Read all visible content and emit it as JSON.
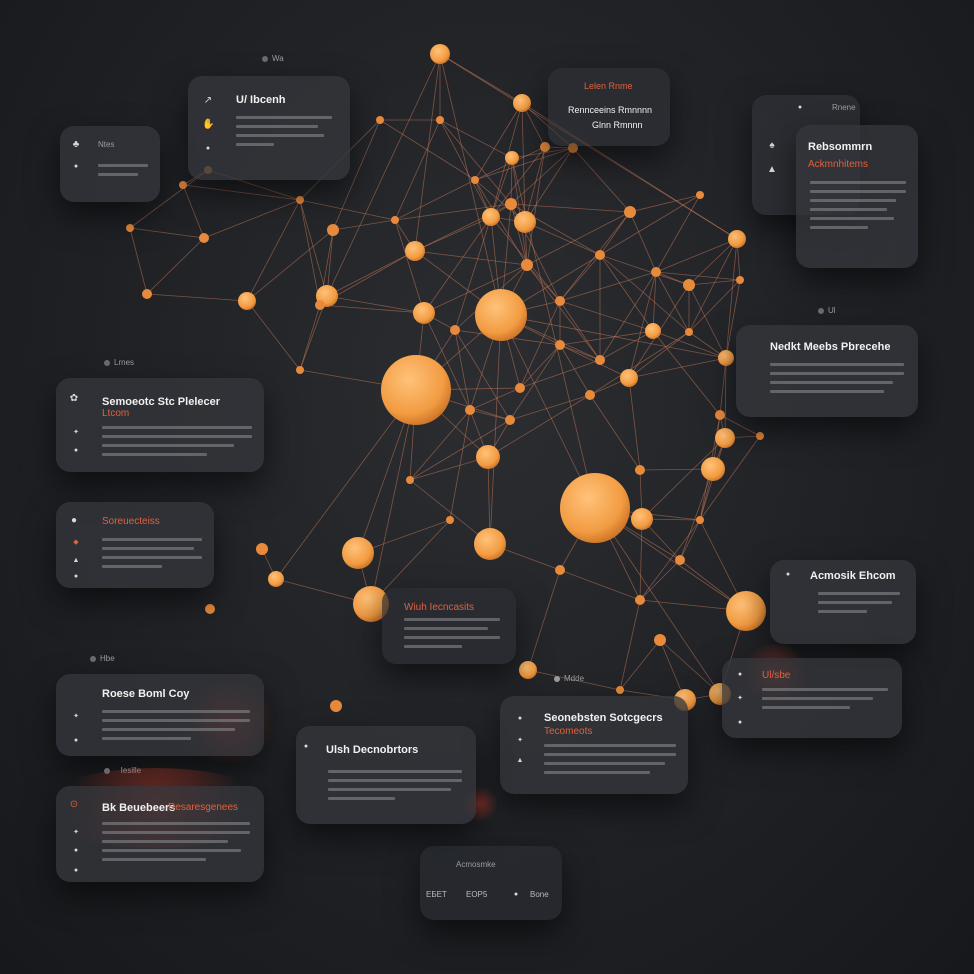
{
  "colors": {
    "background": "#1e2024",
    "node": "#f2a248",
    "link": "#c66a4a",
    "card": "#34363b",
    "accent_red": "#e0613a"
  },
  "cards": {
    "top_left": {
      "tag": "Wa",
      "title": "U/ Ibcenh"
    },
    "left_small": {
      "tag": "Ntes"
    },
    "top_center": {
      "line1": "Lelen Rnme",
      "line2": "Rennceeins Rmnnnn",
      "line3": "Glnn Rmnnn"
    },
    "top_right": {
      "tag": "Rnene",
      "title": "Rebsommrn",
      "subtitle": "Ackmnhitems"
    },
    "mid_right": {
      "tag": "Ul",
      "title": "Nedkt Meebs Pbrecehe"
    },
    "left_mid": {
      "tag": "Lrnes",
      "title": "Semoeotc Stc Plelecer",
      "subtitle": "Ltcom"
    },
    "left_red": {
      "title": "Soreuecteiss"
    },
    "center_small": {
      "title": "Wiuh Iecncasits"
    },
    "right_lower": {
      "title": "Acmosik Ehcom"
    },
    "right_bottom": {
      "title": "Ul/sbe"
    },
    "left_lower": {
      "tag": "Hbe",
      "title": "Roese Boml Coy"
    },
    "bottom_center": {
      "tag": "Mdde",
      "title": "Seonebsten Sotcgecrs",
      "subtitle": "Tecomeots"
    },
    "bottom_mid": {
      "title": "Ulsh Decnobrtors"
    },
    "bottom_left": {
      "tag": "Iesille",
      "title": "Bk Beuebeers",
      "subtitle": "Resaresgenees"
    },
    "footer": {
      "tag": "Acmosmke",
      "item1": "ЕБЕТ",
      "item2": "ЕОР5",
      "item3": "Bone"
    }
  },
  "icons": [
    "settings-icon",
    "person-icon",
    "link-icon",
    "dot-icon",
    "bulb-icon",
    "drop-icon",
    "hand-icon",
    "arrow-icon"
  ]
}
